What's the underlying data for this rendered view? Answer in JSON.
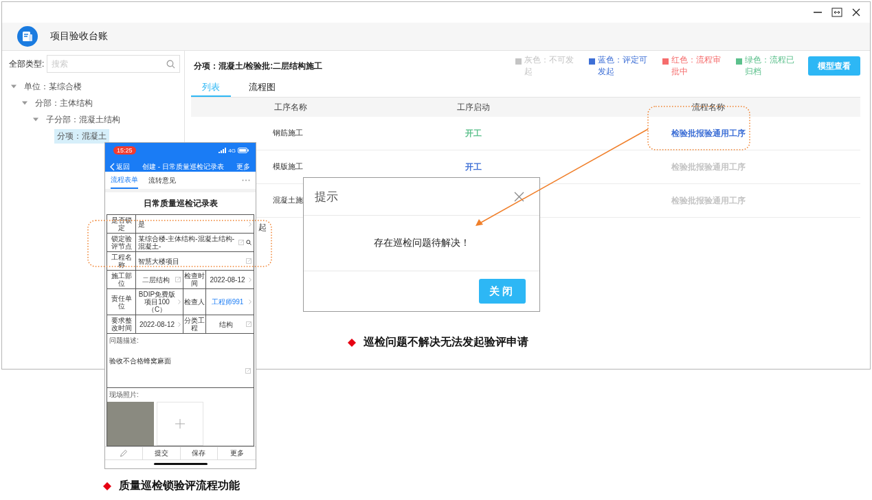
{
  "window": {
    "title": "项目验收台账"
  },
  "sidebar": {
    "filter_label": "全部类型:",
    "search": {
      "placeholder": "搜索"
    },
    "tree": [
      {
        "label": "单位：某综合楼",
        "expanded": true,
        "selected": false,
        "children": [
          {
            "label": "分部：主体结构",
            "expanded": true,
            "selected": false,
            "children": [
              {
                "label": "子分部：混凝土结构",
                "expanded": true,
                "selected": false,
                "children": [
                  {
                    "label": "分项：混凝土",
                    "selected": true
                  }
                ]
              }
            ]
          }
        ]
      }
    ]
  },
  "main": {
    "breadcrumb": "分项：混凝土/检验批:二层结构施工",
    "tabs": [
      {
        "label": "列表",
        "selected": true
      },
      {
        "label": "流程图",
        "selected": false
      }
    ],
    "legend": [
      {
        "label": "灰色：不可发起",
        "color": "#c4c4c4"
      },
      {
        "label": "蓝色：评定可发起",
        "color": "#3d6fd6"
      },
      {
        "label": "红色：流程审批中",
        "color": "#f56c6c"
      },
      {
        "label": "绿色：流程已归档",
        "color": "#5cc08c"
      }
    ],
    "model_button": "模型查看",
    "table": {
      "columns": [
        "工序名称",
        "工序启动",
        "流程名称"
      ],
      "rows": [
        {
          "name": "钢筋施工",
          "start": {
            "text": "开工",
            "color": "#5cc08c"
          },
          "process": {
            "text": "检验批报验通用工序",
            "color": "#3d6fd6"
          }
        },
        {
          "name": "模版施工",
          "start": {
            "text": "开工",
            "color": "#3d6fd6"
          },
          "process": {
            "text": "检验批报验通用工序",
            "color": "#c4c4c4"
          }
        },
        {
          "name": "混凝土施",
          "process": {
            "text": "检验批报验通用工序",
            "color": "#c4c4c4"
          }
        }
      ]
    },
    "covered_text": "起"
  },
  "phone": {
    "time": "15:25",
    "network": "4G",
    "back": "返回",
    "title": "创建 - 日常质量巡检记录表",
    "more": "更多",
    "tabs": [
      {
        "label": "流程表单",
        "selected": true
      },
      {
        "label": "流转意见",
        "selected": false
      }
    ],
    "form_title": "日常质量巡检记录表",
    "rows": [
      {
        "cells": [
          {
            "label": "是否锁定",
            "value": "是",
            "kind": "chevron"
          }
        ]
      },
      {
        "cells": [
          {
            "label": "锁定验评节点",
            "value": "某综合楼-主体结构-混凝土结构-混凝土-",
            "kind": "search"
          }
        ]
      },
      {
        "cells": [
          {
            "label": "工程名称",
            "value": "智慧大楼项目",
            "kind": "edit"
          }
        ]
      },
      {
        "cells": [
          {
            "label": "施工部位",
            "value": "二层结构",
            "kind": "edit"
          },
          {
            "label": "检查时间",
            "value": "2022-08-12",
            "kind": "chevron"
          }
        ]
      },
      {
        "cells": [
          {
            "label": "责任单位",
            "value": "BDIP免费版项目100（C）",
            "kind": "chevron"
          },
          {
            "label": "检查人",
            "value": "工程师991",
            "kind": "chevron",
            "link": true
          }
        ]
      },
      {
        "cells": [
          {
            "label": "要求整改时间",
            "value": "2022-08-12",
            "kind": "chevron"
          },
          {
            "label": "分类工程",
            "value": "结构",
            "kind": "edit"
          }
        ]
      }
    ],
    "description_label": "问题描述:",
    "description": "验收不合格蜂窝麻面",
    "photos_label": "现场照片:",
    "actions": [
      "提交",
      "保存",
      "更多"
    ]
  },
  "dialog": {
    "title": "提示",
    "message": "存在巡检问题待解决！",
    "button": "关闭"
  },
  "captions": [
    "巡检问题不解决无法发起验评申请",
    "质量巡检锁验评流程功能"
  ]
}
